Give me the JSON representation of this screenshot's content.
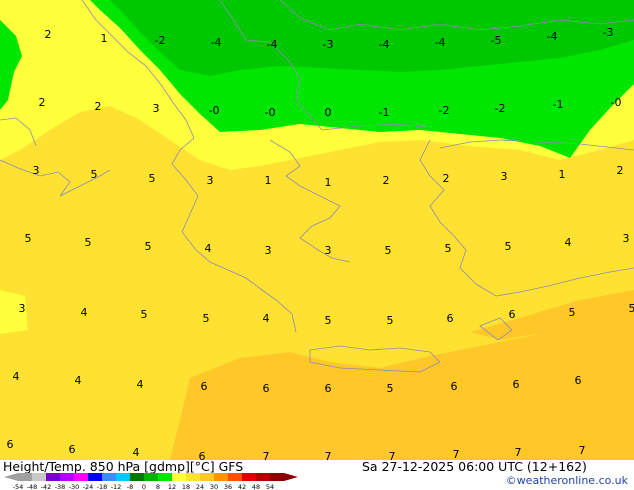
{
  "map": {
    "zones": {
      "dark_green": "#00c800",
      "light_green": "#00e600",
      "yellow": "#ffff3c",
      "gold": "#ffe132",
      "orange": "#ffc828"
    },
    "contour_values": [
      {
        "v": "2"
      },
      {
        "v": "1"
      },
      {
        "v": "-2"
      },
      {
        "v": "-4"
      },
      {
        "v": "-4"
      },
      {
        "v": "-3"
      },
      {
        "v": "-4"
      },
      {
        "v": "-4"
      },
      {
        "v": "-5"
      },
      {
        "v": "-4"
      },
      {
        "v": "-3"
      },
      {
        "v": "2"
      },
      {
        "v": "2"
      },
      {
        "v": "3"
      },
      {
        "v": "-0"
      },
      {
        "v": "-0"
      },
      {
        "v": "0"
      },
      {
        "v": "-1"
      },
      {
        "v": "-2"
      },
      {
        "v": "-2"
      },
      {
        "v": "-1"
      },
      {
        "v": "-0"
      },
      {
        "v": "3"
      },
      {
        "v": "5"
      },
      {
        "v": "5"
      },
      {
        "v": "3"
      },
      {
        "v": "1"
      },
      {
        "v": "1"
      },
      {
        "v": "2"
      },
      {
        "v": "2"
      },
      {
        "v": "3"
      },
      {
        "v": "1"
      },
      {
        "v": "2"
      },
      {
        "v": "5"
      },
      {
        "v": "5"
      },
      {
        "v": "5"
      },
      {
        "v": "4"
      },
      {
        "v": "3"
      },
      {
        "v": "3"
      },
      {
        "v": "5"
      },
      {
        "v": "5"
      },
      {
        "v": "5"
      },
      {
        "v": "4"
      },
      {
        "v": "3"
      },
      {
        "v": "3"
      },
      {
        "v": "4"
      },
      {
        "v": "5"
      },
      {
        "v": "5"
      },
      {
        "v": "4"
      },
      {
        "v": "5"
      },
      {
        "v": "5"
      },
      {
        "v": "6"
      },
      {
        "v": "6"
      },
      {
        "v": "5"
      },
      {
        "v": "5"
      },
      {
        "v": "4"
      },
      {
        "v": "4"
      },
      {
        "v": "4"
      },
      {
        "v": "6"
      },
      {
        "v": "6"
      },
      {
        "v": "6"
      },
      {
        "v": "5"
      },
      {
        "v": "6"
      },
      {
        "v": "6"
      },
      {
        "v": "6"
      },
      {
        "v": "6"
      },
      {
        "v": "6"
      },
      {
        "v": "4"
      },
      {
        "v": "6"
      },
      {
        "v": "7"
      },
      {
        "v": "7"
      },
      {
        "v": "7"
      },
      {
        "v": "7"
      },
      {
        "v": "7"
      },
      {
        "v": "7"
      }
    ]
  },
  "footer": {
    "title": "Height/Temp. 850 hPa [gdmp][°C] GFS",
    "datetime": "Sa 27-12-2025 06:00 UTC (12+162)",
    "credit": "©weatheronline.co.uk"
  },
  "scale": {
    "ticks": [
      "-54",
      "-48",
      "-42",
      "-38",
      "-30",
      "-24",
      "-18",
      "-12",
      "-8",
      "0",
      "8",
      "12",
      "18",
      "24",
      "30",
      "36",
      "42",
      "48",
      "54"
    ],
    "colors": [
      "#a0a0a0",
      "#c8c8c8",
      "#7800c8",
      "#b400ff",
      "#ff00ff",
      "#0000ff",
      "#3c8cff",
      "#00c8ff",
      "#007800",
      "#00b400",
      "#00e600",
      "#ffff3c",
      "#ffe132",
      "#ffc828",
      "#ff9600",
      "#ff5000",
      "#dc0000",
      "#b40000",
      "#8c0000"
    ]
  }
}
